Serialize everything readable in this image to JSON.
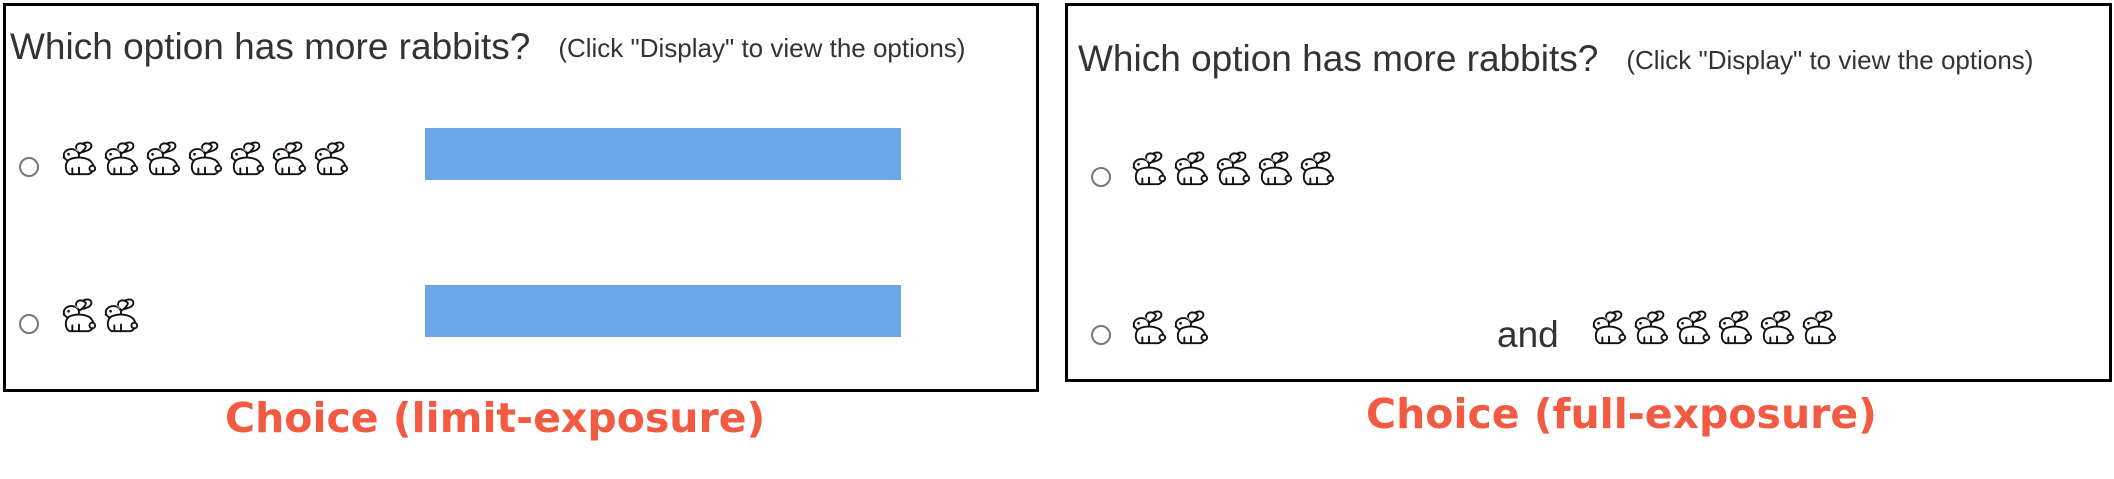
{
  "colors": {
    "caption": "#f25a42",
    "cover_bar": "#6aa7e7",
    "panel_border": "#000000",
    "question_text": "#333333"
  },
  "panels": [
    {
      "question": "Which option has more rabbits?",
      "hint": "(Click \"Display\" to view the options)",
      "options": [
        {
          "rabbits": 7,
          "hidden_by_bar": true
        },
        {
          "rabbits": 2,
          "hidden_by_bar": true
        }
      ],
      "caption": "Choice (limit-exposure)"
    },
    {
      "question": "Which option has more rabbits?",
      "hint": "(Click \"Display\" to view the options)",
      "options": [
        {
          "rabbits": 5
        },
        {
          "rabbits": 2,
          "joiner": "and",
          "extra_rabbits": 6
        }
      ],
      "caption": "Choice (full-exposure)"
    }
  ],
  "icons": {
    "rabbit": "rabbit-icon",
    "radio": "radio-button"
  }
}
